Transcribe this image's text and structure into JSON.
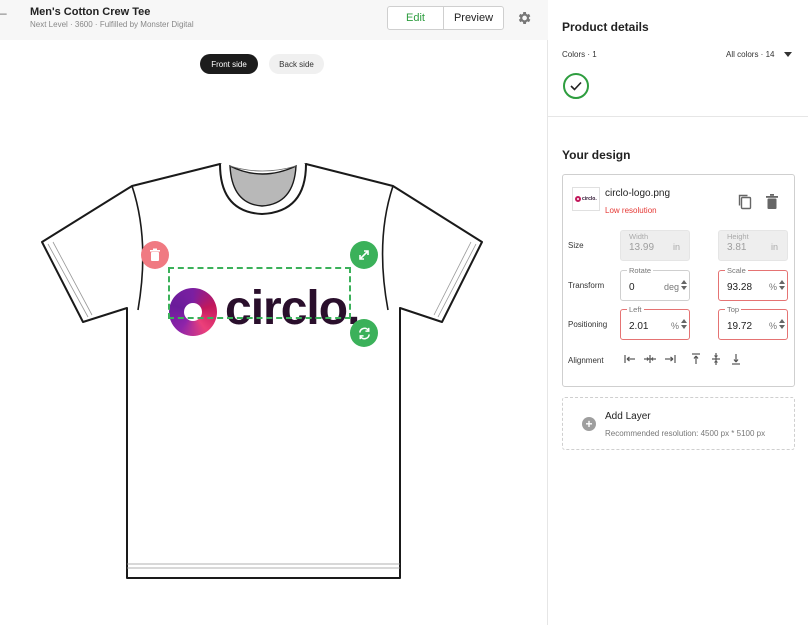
{
  "header": {
    "back_glyph": "–",
    "product_title": "Men's Cotton Crew Tee",
    "product_subtitle": "Next Level · 3600 · Fulfilled by Monster Digital",
    "edit_label": "Edit",
    "preview_label": "Preview",
    "accent_color": "#2e9d3f"
  },
  "canvas": {
    "front_label": "Front side",
    "back_label": "Back side",
    "active_side": "Front side",
    "logo_text": "circlo."
  },
  "details": {
    "title": "Product details",
    "colors_label": "Colors · 1",
    "all_colors_label": "All colors · 14",
    "selected_color": "#ffffff"
  },
  "design": {
    "title": "Your design",
    "file_name": "circlo-logo.png",
    "warning": "Low resolution",
    "thumb_text": "circlo.",
    "size": {
      "label": "Size",
      "width_label": "Width",
      "width_value": "13.99",
      "width_unit": "in",
      "height_label": "Height",
      "height_value": "3.81",
      "height_unit": "in"
    },
    "transform": {
      "label": "Transform",
      "rotate_label": "Rotate",
      "rotate_value": "0",
      "rotate_unit": "deg",
      "scale_label": "Scale",
      "scale_value": "93.28",
      "scale_unit": "%"
    },
    "positioning": {
      "label": "Positioning",
      "left_label": "Left",
      "left_value": "2.01",
      "left_unit": "%",
      "top_label": "Top",
      "top_value": "19.72",
      "top_unit": "%"
    },
    "alignment_label": "Alignment",
    "alignment_icons": [
      "align-left-icon",
      "align-center-h-icon",
      "align-right-icon",
      "align-top-icon",
      "align-center-v-icon",
      "align-bottom-icon"
    ]
  },
  "add_layer": {
    "title": "Add Layer",
    "subtitle": "Recommended resolution: 4500 px * 5100 px"
  }
}
